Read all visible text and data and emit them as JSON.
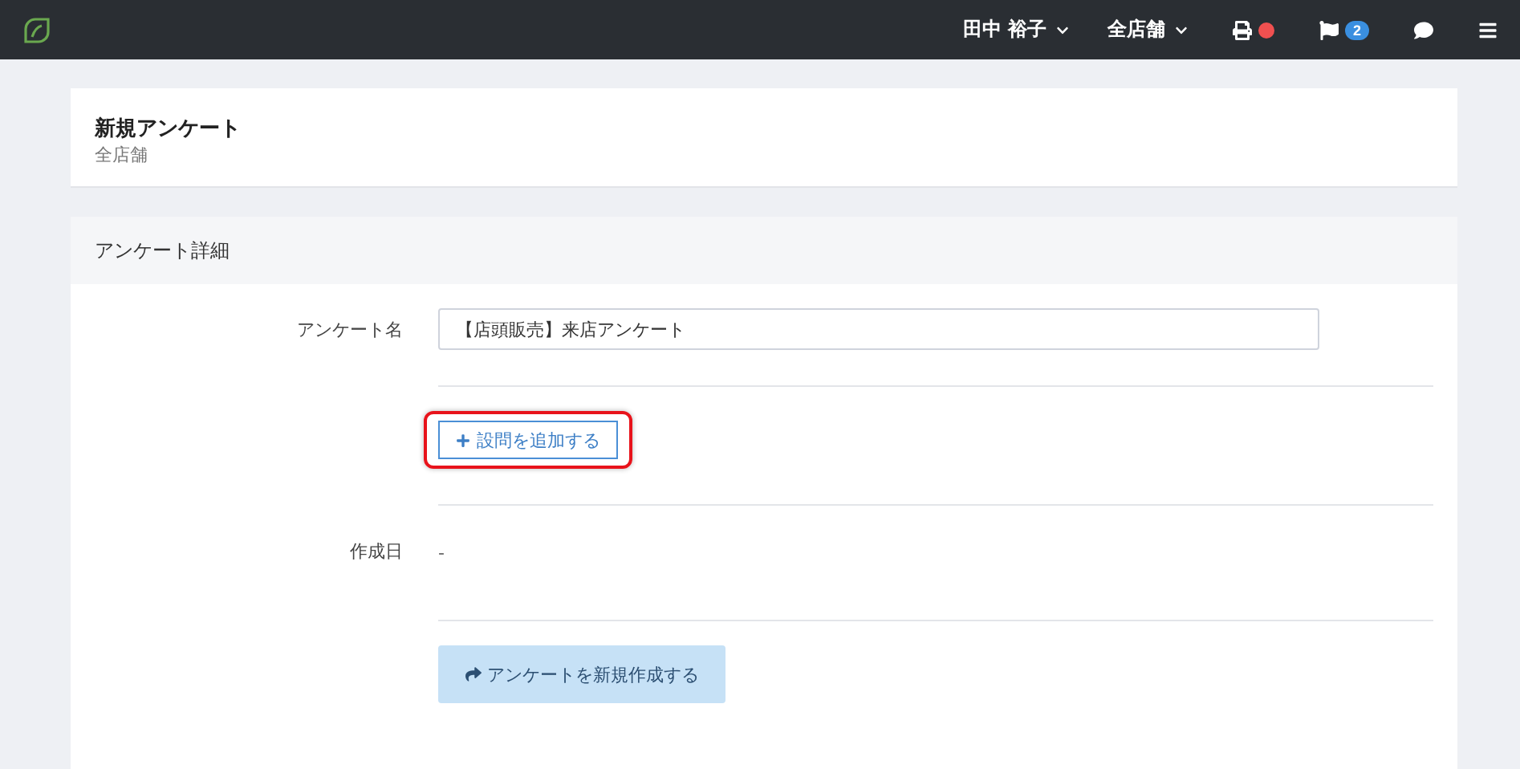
{
  "topbar": {
    "user": "田中 裕子",
    "store": "全店舗",
    "notifications": [
      {
        "kind": "printer",
        "color": "#f05050"
      },
      {
        "kind": "flag",
        "badge": "2"
      },
      {
        "kind": "comment"
      },
      {
        "kind": "menu"
      }
    ]
  },
  "header": {
    "title": "新規アンケート",
    "subtitle": "全店舗"
  },
  "section": {
    "title": "アンケート詳細",
    "rows": [
      {
        "kind": "input",
        "label": "アンケート名",
        "value": "【店頭販売】来店アンケート"
      },
      {
        "kind": "add",
        "button": "設問を追加する",
        "highlighted": true
      },
      {
        "kind": "text",
        "label": "作成日",
        "value": "-"
      },
      {
        "kind": "submit",
        "button": "アンケートを新規作成する",
        "disabled": true
      }
    ]
  }
}
